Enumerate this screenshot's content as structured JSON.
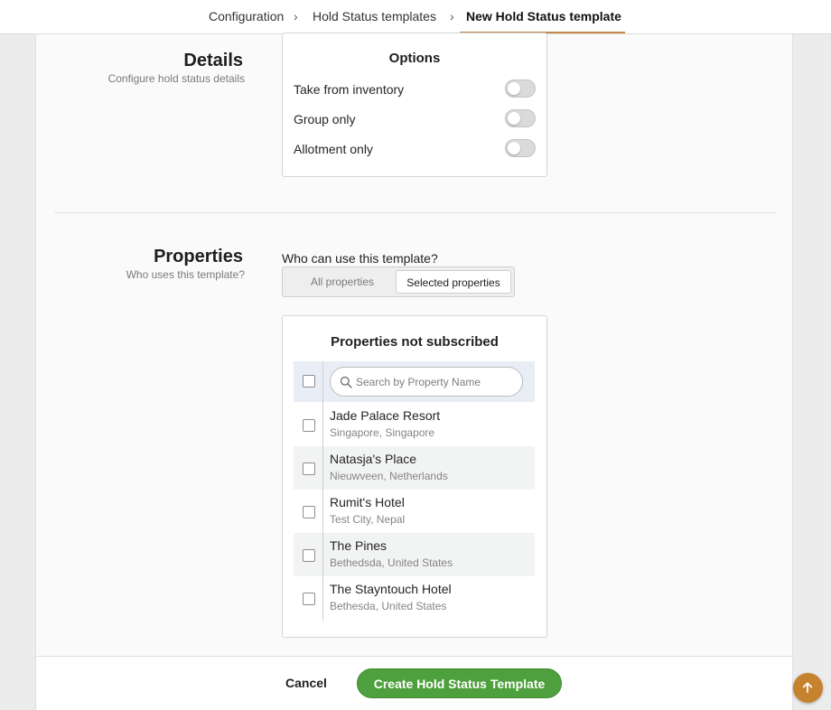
{
  "breadcrumb": {
    "items": [
      "Configuration",
      "Hold Status templates",
      "New Hold Status template"
    ],
    "separator": "›"
  },
  "details": {
    "title": "Details",
    "subtitle": "Configure hold status details",
    "options": {
      "title": "Options",
      "items": [
        {
          "label": "Take from inventory",
          "enabled": false
        },
        {
          "label": "Group only",
          "enabled": false
        },
        {
          "label": "Allotment only",
          "enabled": false
        }
      ]
    }
  },
  "properties": {
    "title": "Properties",
    "subtitle": "Who uses this template?",
    "question": "Who can use this template?",
    "scope": {
      "options": [
        "All properties",
        "Selected properties"
      ],
      "selected": "Selected properties"
    },
    "list": {
      "title": "Properties not subscribed",
      "search_placeholder": "Search by Property Name",
      "items": [
        {
          "name": "Jade Palace Resort",
          "location": "Singapore, Singapore",
          "checked": false
        },
        {
          "name": "Natasja's Place",
          "location": "Nieuwveen, Netherlands",
          "checked": false
        },
        {
          "name": "Rumit's Hotel",
          "location": "Test City, Nepal",
          "checked": false
        },
        {
          "name": "The Pines",
          "location": "Bethedsda, United States",
          "checked": false
        },
        {
          "name": "The Stayntouch Hotel",
          "location": "Bethesda, United States",
          "checked": false
        }
      ]
    }
  },
  "footer": {
    "cancel_label": "Cancel",
    "create_label": "Create Hold Status Template"
  },
  "icons": {
    "search": "search-icon",
    "scroll_top": "arrow-up-icon",
    "separator": "chevron-right-icon"
  },
  "colors": {
    "primary_button": "#4e9f3d",
    "breadcrumb_underline": "#c6884a",
    "fab": "#c7822f",
    "search_row_bg": "#e8edf6"
  }
}
